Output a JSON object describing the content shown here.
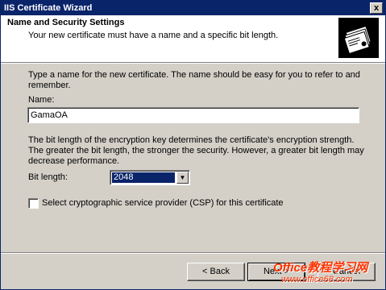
{
  "window": {
    "title": "IIS Certificate Wizard",
    "close_glyph": "x"
  },
  "header": {
    "title": "Name and Security Settings",
    "subtitle": "Your new certificate must have a name and a specific bit length.",
    "icon": "certificate-stack-icon"
  },
  "intro": "Type a name for the new certificate. The name should be easy for you to refer to and remember.",
  "name_field": {
    "label": "Name:",
    "value": "GamaOA"
  },
  "bit_description": "The bit length of the encryption key determines the certificate's encryption strength. The greater the bit length, the stronger the security.  However, a greater bit length may decrease performance.",
  "bit_length": {
    "label": "Bit length:",
    "value": "2048"
  },
  "csp": {
    "label": "Select cryptographic service provider (CSP) for this certificate",
    "checked": false
  },
  "buttons": {
    "back": "< Back",
    "next": "Next >",
    "cancel": "Cancel"
  },
  "watermark": {
    "line1": "Office教程学习网",
    "line2": "www.office68.com"
  },
  "colors": {
    "titlebar": "#0a246a",
    "face": "#d4d0c8",
    "selection": "#0a246a",
    "watermark": "#ff3300"
  }
}
